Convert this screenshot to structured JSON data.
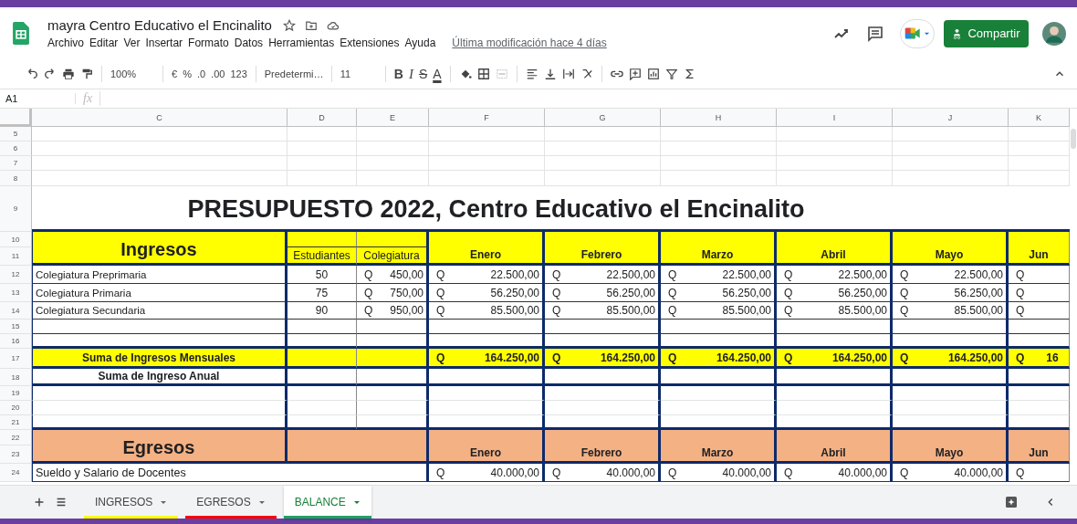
{
  "app_bar": {
    "title": "mayra Centro Educativo el Encinalito",
    "menu": [
      "Archivo",
      "Editar",
      "Ver",
      "Insertar",
      "Formato",
      "Datos",
      "Herramientas",
      "Extensiones",
      "Ayuda"
    ],
    "last_edit": "Última modificación hace 4 días",
    "share_button": "Compartir"
  },
  "toolbar": {
    "zoom": "100%",
    "currency": "€",
    "percent": "%",
    "decrease_decimals": ".0",
    "increase_decimals": ".00",
    "number_format": "123",
    "font": "Predetermi…",
    "font_size": "11",
    "bold": "B",
    "italic": "I",
    "strikethrough": "S",
    "text_color": "A"
  },
  "formula_bar": {
    "cell_ref": "A1",
    "fx": "fx"
  },
  "columns": [
    "C",
    "D",
    "E",
    "F",
    "G",
    "H",
    "I",
    "J",
    "K"
  ],
  "rows": [
    "5",
    "6",
    "7",
    "8",
    "9",
    "10",
    "11",
    "12",
    "13",
    "14",
    "15",
    "16",
    "17",
    "18",
    "19",
    "20",
    "21",
    "22",
    "23",
    "24"
  ],
  "title": "PRESUPUESTO 2022, Centro Educativo el Encinalito",
  "ingresos": {
    "heading": "Ingresos",
    "columns": [
      "Estudiantes",
      "Colegiatura"
    ],
    "months": [
      "Enero",
      "Febrero",
      "Marzo",
      "Abril",
      "Mayo",
      "Jun"
    ],
    "rows": [
      {
        "label": "Colegiatura Preprimaria",
        "students": "50",
        "fee": {
          "currency": "Q",
          "amount": "450,00"
        },
        "monthly": [
          {
            "currency": "Q",
            "amount": "22.500,00"
          },
          {
            "currency": "Q",
            "amount": "22.500,00"
          },
          {
            "currency": "Q",
            "amount": "22.500,00"
          },
          {
            "currency": "Q",
            "amount": "22.500,00"
          },
          {
            "currency": "Q",
            "amount": "22.500,00"
          },
          {
            "currency": "Q"
          }
        ]
      },
      {
        "label": "Colegiatura Primaria",
        "students": "75",
        "fee": {
          "currency": "Q",
          "amount": "750,00"
        },
        "monthly": [
          {
            "currency": "Q",
            "amount": "56.250,00"
          },
          {
            "currency": "Q",
            "amount": "56.250,00"
          },
          {
            "currency": "Q",
            "amount": "56.250,00"
          },
          {
            "currency": "Q",
            "amount": "56.250,00"
          },
          {
            "currency": "Q",
            "amount": "56.250,00"
          },
          {
            "currency": "Q"
          }
        ]
      },
      {
        "label": "Colegiatura Secundaria",
        "students": "90",
        "fee": {
          "currency": "Q",
          "amount": "950,00"
        },
        "monthly": [
          {
            "currency": "Q",
            "amount": "85.500,00"
          },
          {
            "currency": "Q",
            "amount": "85.500,00"
          },
          {
            "currency": "Q",
            "amount": "85.500,00"
          },
          {
            "currency": "Q",
            "amount": "85.500,00"
          },
          {
            "currency": "Q",
            "amount": "85.500,00"
          },
          {
            "currency": "Q"
          }
        ]
      }
    ],
    "total": {
      "label": "Suma de Ingresos Mensuales",
      "values": [
        {
          "currency": "Q",
          "amount": "164.250,00"
        },
        {
          "currency": "Q",
          "amount": "164.250,00"
        },
        {
          "currency": "Q",
          "amount": "164.250,00"
        },
        {
          "currency": "Q",
          "amount": "164.250,00"
        },
        {
          "currency": "Q",
          "amount": "164.250,00"
        },
        {
          "currency": "Q",
          "amount": "16"
        }
      ]
    },
    "annual_label": "Suma de Ingreso Anual"
  },
  "egresos": {
    "heading": "Egresos",
    "months": [
      "Enero",
      "Febrero",
      "Marzo",
      "Abril",
      "Mayo",
      "Jun"
    ],
    "first_row": {
      "label": "Sueldo y Salario de Docentes",
      "values": [
        {
          "currency": "Q",
          "amount": "40.000,00"
        },
        {
          "currency": "Q",
          "amount": "40.000,00"
        },
        {
          "currency": "Q",
          "amount": "40.000,00"
        },
        {
          "currency": "Q",
          "amount": "40.000,00"
        },
        {
          "currency": "Q",
          "amount": "40.000,00"
        },
        {
          "currency": "Q"
        }
      ]
    }
  },
  "sheet_tabs": [
    {
      "label": "INGRESOS",
      "color": "#ffff00",
      "selected": false
    },
    {
      "label": "EGRESOS",
      "color": "#ff0000",
      "selected": false
    },
    {
      "label": "BALANCE",
      "color": "#1ea362",
      "selected": true
    }
  ]
}
